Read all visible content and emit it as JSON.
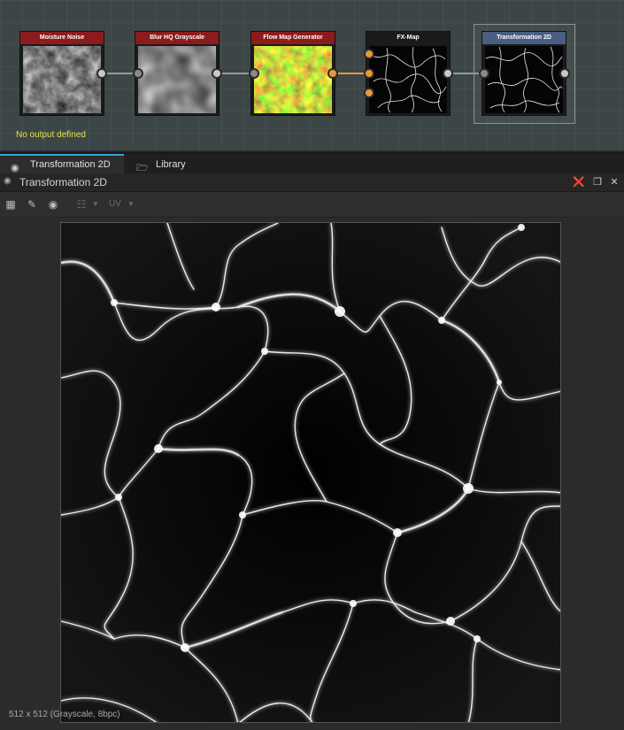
{
  "graph": {
    "nodes": [
      {
        "title": "Moisture Noise",
        "header_color": "#8e1b1b",
        "thumb": "noise"
      },
      {
        "title": "Blur HQ Grayscale",
        "header_color": "#8e1b1b",
        "thumb": "blur"
      },
      {
        "title": "Flow Map Generator",
        "header_color": "#8e1b1b",
        "thumb": "flow"
      },
      {
        "title": "FX-Map",
        "header_color": "#1b1b1b",
        "thumb": "fx"
      },
      {
        "title": "Transformation 2D",
        "header_color": "#4a5d83",
        "thumb": "fx"
      }
    ],
    "no_output": "No output defined"
  },
  "tabs": [
    {
      "label": "Transformation 2D",
      "icon": "graph-icon",
      "active": true
    },
    {
      "label": "Library",
      "icon": "folder-icon",
      "active": false
    }
  ],
  "panel": {
    "title": "Transformation 2D"
  },
  "toolbar": {
    "uv_label": "UV"
  },
  "status": {
    "text": "512 x 512 (Grayscale, 8bpc)"
  },
  "colors": {
    "accent": "#38a3d6",
    "node_warning": "#e8e04a",
    "connection_active": "#e89a3a"
  }
}
